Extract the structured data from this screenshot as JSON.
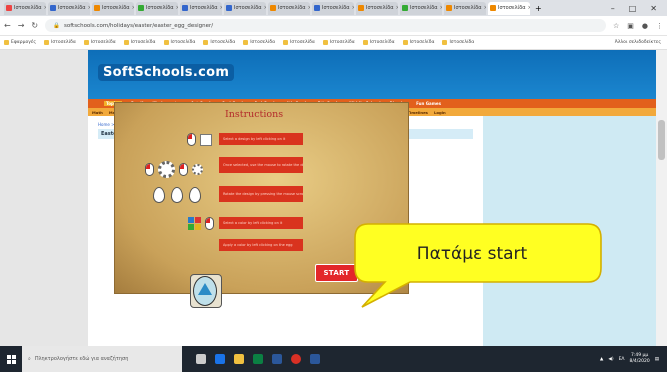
{
  "browser": {
    "tabs": [
      {
        "label": "Ιστοσελίδα",
        "color": "#e44"
      },
      {
        "label": "Ιστοσελίδα",
        "color": "#36c"
      },
      {
        "label": "Ιστοσελίδα",
        "color": "#e80"
      },
      {
        "label": "Ιστοσελίδα",
        "color": "#3a3"
      },
      {
        "label": "Ιστοσελίδα",
        "color": "#36c"
      },
      {
        "label": "Ιστοσελίδα",
        "color": "#36c"
      },
      {
        "label": "Ιστοσελίδα",
        "color": "#e80"
      },
      {
        "label": "Ιστοσελίδα",
        "color": "#36c"
      },
      {
        "label": "Ιστοσελίδα",
        "color": "#e80"
      },
      {
        "label": "Ιστοσελίδα",
        "color": "#3a3"
      },
      {
        "label": "Ιστοσελίδα",
        "color": "#e80"
      },
      {
        "label": "Ιστοσελίδα",
        "color": "#e80"
      }
    ],
    "url": "softschools.com/holidays/easter/easter_egg_designer/",
    "bookmarks": [
      "Εφαρμογές",
      "Ιστοσελίδα",
      "Ιστοσελίδα",
      "Ιστοσελίδα",
      "Ιστοσελίδα",
      "Ιστοσελίδα",
      "Ιστοσελίδα",
      "Ιστοσελίδα",
      "Ιστοσελίδα",
      "Ιστοσελίδα",
      "Ιστοσελίδα",
      "Ιστοσελίδα"
    ],
    "bookmarks_right": "Άλλοι σελιδοδείκτες"
  },
  "site": {
    "logo": "SoftSchools.com",
    "nav1": [
      "Topics",
      "Pre-K",
      "Kindergarten",
      "1st Grade",
      "2nd Grade",
      "3rd Grade",
      "4th Grade",
      "5th Grade",
      "Middle School",
      "Phonics",
      "Fun Games"
    ],
    "nav2": [
      "Math",
      "Math Quizzes",
      "Math Worksheets",
      "Algebra",
      "Language Arts",
      "Science",
      "Social Studies",
      "Literature",
      "Languages",
      "Themes",
      "Quizzes",
      "Timelines",
      "Login"
    ],
    "breadcrumb": "Home > Fun Games > Educational Games > Easter Egg Designer",
    "page_title": "Easter Egg Designer"
  },
  "game": {
    "title": "Instructions",
    "steps": [
      "Select a design by left clicking on it",
      "Once selected, use the mouse to rotate the design. Use + and - keys to adjust its size",
      "Rotate the design by pressing the mouse scroll. Use mouse / keys",
      "Select a color by left clicking on it",
      "Apply a color by left clicking on the egg"
    ],
    "start_label": "START"
  },
  "callout": {
    "text": "Πατάμε start",
    "fill": "#ffff22",
    "stroke": "#d4b000"
  },
  "taskbar": {
    "search_placeholder": "Πληκτρολογήστε εδώ για αναζήτηση",
    "time": "7:49 μμ",
    "date": "8/4/2020",
    "lang": "ΕΛ"
  }
}
